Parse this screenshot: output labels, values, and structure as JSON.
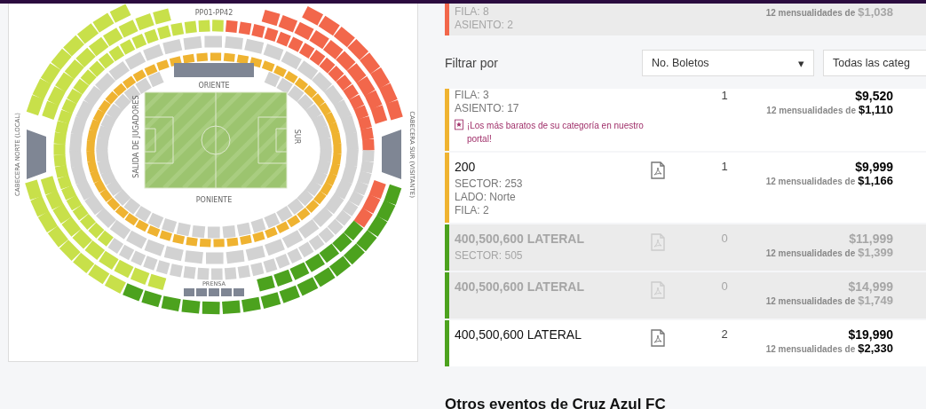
{
  "map": {
    "labels": [
      {
        "kind": "upper",
        "text": "PP01-PP42"
      },
      {
        "kind": "top",
        "text": "ORIENTE"
      },
      {
        "kind": "westend",
        "text": "CABECERA NORTE (LOCAL)"
      },
      {
        "kind": "left",
        "text": "SALIDA DE JUGADORES"
      },
      {
        "kind": "right",
        "text": "SUR"
      },
      {
        "kind": "eastend",
        "text": "CABECERA SUR (VISITANTE)"
      },
      {
        "kind": "bottom",
        "text": "PONIENTE"
      },
      {
        "kind": "press",
        "text": "PRENSA"
      }
    ],
    "tiers": [
      {
        "segments": [
          {
            "color": "#d2d2d2"
          }
        ]
      },
      {
        "segments": [
          {
            "color": "#efb331"
          }
        ]
      },
      {
        "segments": [
          {
            "color": "#d2d2d2"
          }
        ]
      },
      {
        "segments": [
          {
            "color": "#f2674b"
          },
          {
            "color": "#d2d2d2"
          },
          {
            "color": "#c8e04a"
          }
        ]
      },
      {
        "segments": [
          {
            "color": "#f2674b"
          },
          {
            "color": "#4ca21e"
          },
          {
            "color": "#c8e04a"
          }
        ]
      },
      {
        "segments": [
          {
            "color": "#f2674b"
          },
          {
            "color": "#4ca21e"
          },
          {
            "color": "#c8e04a"
          }
        ]
      }
    ]
  },
  "tickets_top": [
    {
      "color": "#f2674b",
      "disabled": true,
      "details": [
        "FILA: 8",
        "ASIENTO: 2"
      ],
      "monthly_label": "12 mensualidades de",
      "monthly": "$1,038"
    }
  ],
  "filter": {
    "label": "Filtrar por",
    "selects": [
      {
        "value": "No. Boletos",
        "caret": "▾"
      },
      {
        "value": "Todas las categ"
      }
    ]
  },
  "tickets": [
    {
      "color": "#efb331",
      "disabled": false,
      "pdf": false,
      "details": [
        "FILA: 3",
        "ASIENTO: 17"
      ],
      "promo": "¡Los más baratos de su categoría en nuestro portal!",
      "quantity": "1",
      "price": "$9,520",
      "monthly_label": "12 mensualidades de",
      "monthly": "$1,110"
    },
    {
      "color": "#efb331",
      "disabled": false,
      "pdf": true,
      "title": "200",
      "details": [
        "SECTOR: 253",
        "LADO: Norte",
        "FILA: 2"
      ],
      "quantity": "1",
      "price": "$9,999",
      "monthly_label": "12 mensualidades de",
      "monthly": "$1,166"
    },
    {
      "color": "#4ca21e",
      "disabled": true,
      "pdf": true,
      "title": "400,500,600 LATERAL",
      "details": [
        "SECTOR: 505"
      ],
      "quantity": "0",
      "price": "$11,999",
      "monthly_label": "12 mensualidades de",
      "monthly": "$1,399"
    },
    {
      "color": "#4ca21e",
      "disabled": true,
      "pdf": true,
      "title": "400,500,600 LATERAL",
      "quantity": "0",
      "price": "$14,999",
      "monthly_label": "12 mensualidades de",
      "monthly": "$1,749"
    },
    {
      "color": "#4ca21e",
      "disabled": false,
      "pdf": true,
      "title": "400,500,600 LATERAL",
      "quantity": "2",
      "price": "$19,990",
      "monthly_label": "12 mensualidades de",
      "monthly": "$2,330"
    }
  ],
  "other_events": {
    "title": "Otros eventos de Cruz Azul FC"
  }
}
